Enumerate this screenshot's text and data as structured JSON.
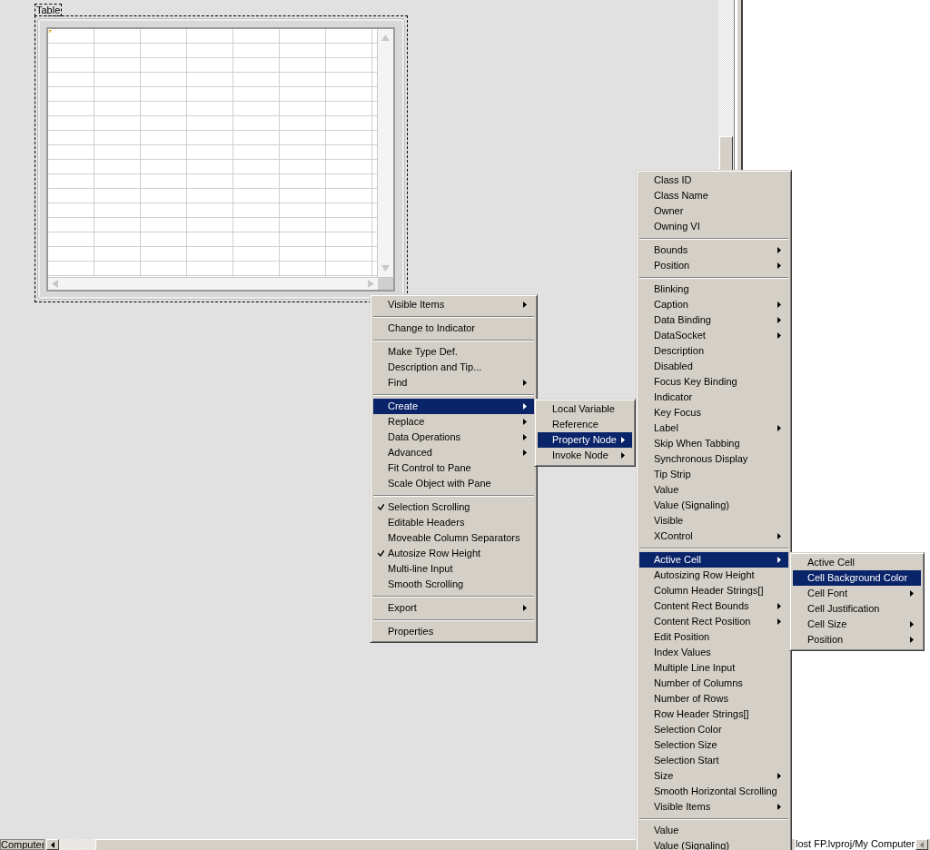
{
  "table": {
    "label": "Table"
  },
  "status_bar": {
    "left_text": "Computer",
    "right_text": "lost FP.lvproj/My Computer"
  },
  "menus": [
    {
      "groups": [
        [
          {
            "label": "Visible Items",
            "submenu": true,
            "selected": false,
            "checked": false
          }
        ],
        [
          {
            "label": "Change to Indicator",
            "submenu": false,
            "selected": false,
            "checked": false
          }
        ],
        [
          {
            "label": "Make Type Def.",
            "submenu": false,
            "selected": false,
            "checked": false
          },
          {
            "label": "Description and Tip...",
            "submenu": false,
            "selected": false,
            "checked": false
          },
          {
            "label": "Find",
            "submenu": true,
            "selected": false,
            "checked": false
          }
        ],
        [
          {
            "label": "Create",
            "submenu": true,
            "selected": true,
            "checked": false
          },
          {
            "label": "Replace",
            "submenu": true,
            "selected": false,
            "checked": false
          },
          {
            "label": "Data Operations",
            "submenu": true,
            "selected": false,
            "checked": false
          },
          {
            "label": "Advanced",
            "submenu": true,
            "selected": false,
            "checked": false
          },
          {
            "label": "Fit Control to Pane",
            "submenu": false,
            "selected": false,
            "checked": false
          },
          {
            "label": "Scale Object with Pane",
            "submenu": false,
            "selected": false,
            "checked": false
          }
        ],
        [
          {
            "label": "Selection Scrolling",
            "submenu": false,
            "selected": false,
            "checked": true
          },
          {
            "label": "Editable Headers",
            "submenu": false,
            "selected": false,
            "checked": false
          },
          {
            "label": "Moveable Column Separators",
            "submenu": false,
            "selected": false,
            "checked": false
          },
          {
            "label": "Autosize Row Height",
            "submenu": false,
            "selected": false,
            "checked": true
          },
          {
            "label": "Multi-line Input",
            "submenu": false,
            "selected": false,
            "checked": false
          },
          {
            "label": "Smooth Scrolling",
            "submenu": false,
            "selected": false,
            "checked": false
          }
        ],
        [
          {
            "label": "Export",
            "submenu": true,
            "selected": false,
            "checked": false
          }
        ],
        [
          {
            "label": "Properties",
            "submenu": false,
            "selected": false,
            "checked": false
          }
        ]
      ]
    },
    {
      "groups": [
        [
          {
            "label": "Local Variable",
            "submenu": false,
            "selected": false
          },
          {
            "label": "Reference",
            "submenu": false,
            "selected": false
          },
          {
            "label": "Property Node",
            "submenu": true,
            "selected": true
          },
          {
            "label": "Invoke Node",
            "submenu": true,
            "selected": false
          }
        ]
      ]
    },
    {
      "groups": [
        [
          {
            "label": "Class ID",
            "submenu": false,
            "selected": false
          },
          {
            "label": "Class Name",
            "submenu": false,
            "selected": false
          },
          {
            "label": "Owner",
            "submenu": false,
            "selected": false
          },
          {
            "label": "Owning VI",
            "submenu": false,
            "selected": false
          }
        ],
        [
          {
            "label": "Bounds",
            "submenu": true,
            "selected": false
          },
          {
            "label": "Position",
            "submenu": true,
            "selected": false
          }
        ],
        [
          {
            "label": "Blinking",
            "submenu": false,
            "selected": false
          },
          {
            "label": "Caption",
            "submenu": true,
            "selected": false
          },
          {
            "label": "Data Binding",
            "submenu": true,
            "selected": false
          },
          {
            "label": "DataSocket",
            "submenu": true,
            "selected": false
          },
          {
            "label": "Description",
            "submenu": false,
            "selected": false
          },
          {
            "label": "Disabled",
            "submenu": false,
            "selected": false
          },
          {
            "label": "Focus Key Binding",
            "submenu": false,
            "selected": false
          },
          {
            "label": "Indicator",
            "submenu": false,
            "selected": false
          },
          {
            "label": "Key Focus",
            "submenu": false,
            "selected": false
          },
          {
            "label": "Label",
            "submenu": true,
            "selected": false
          },
          {
            "label": "Skip When Tabbing",
            "submenu": false,
            "selected": false
          },
          {
            "label": "Synchronous Display",
            "submenu": false,
            "selected": false
          },
          {
            "label": "Tip Strip",
            "submenu": false,
            "selected": false
          },
          {
            "label": "Value",
            "submenu": false,
            "selected": false
          },
          {
            "label": "Value (Signaling)",
            "submenu": false,
            "selected": false
          },
          {
            "label": "Visible",
            "submenu": false,
            "selected": false
          },
          {
            "label": "XControl",
            "submenu": true,
            "selected": false
          }
        ],
        [
          {
            "label": "Active Cell",
            "submenu": true,
            "selected": true
          },
          {
            "label": "Autosizing Row Height",
            "submenu": false,
            "selected": false
          },
          {
            "label": "Column Header Strings[]",
            "submenu": false,
            "selected": false
          },
          {
            "label": "Content Rect Bounds",
            "submenu": true,
            "selected": false
          },
          {
            "label": "Content Rect Position",
            "submenu": true,
            "selected": false
          },
          {
            "label": "Edit Position",
            "submenu": false,
            "selected": false
          },
          {
            "label": "Index Values",
            "submenu": false,
            "selected": false
          },
          {
            "label": "Multiple Line Input",
            "submenu": false,
            "selected": false
          },
          {
            "label": "Number of Columns",
            "submenu": false,
            "selected": false
          },
          {
            "label": "Number of Rows",
            "submenu": false,
            "selected": false
          },
          {
            "label": "Row Header Strings[]",
            "submenu": false,
            "selected": false
          },
          {
            "label": "Selection Color",
            "submenu": false,
            "selected": false
          },
          {
            "label": "Selection Size",
            "submenu": false,
            "selected": false
          },
          {
            "label": "Selection Start",
            "submenu": false,
            "selected": false
          },
          {
            "label": "Size",
            "submenu": true,
            "selected": false
          },
          {
            "label": "Smooth Horizontal Scrolling",
            "submenu": false,
            "selected": false
          },
          {
            "label": "Visible Items",
            "submenu": true,
            "selected": false
          }
        ],
        [
          {
            "label": "Value",
            "submenu": false,
            "selected": false
          },
          {
            "label": "Value (Signaling)",
            "submenu": false,
            "selected": false
          }
        ]
      ]
    },
    {
      "groups": [
        [
          {
            "label": "Active Cell",
            "submenu": false,
            "selected": false
          },
          {
            "label": "Cell Background Color",
            "submenu": false,
            "selected": true
          },
          {
            "label": "Cell Font",
            "submenu": true,
            "selected": false
          },
          {
            "label": "Cell Justification",
            "submenu": false,
            "selected": false
          },
          {
            "label": "Cell Size",
            "submenu": true,
            "selected": false
          },
          {
            "label": "Position",
            "submenu": true,
            "selected": false
          }
        ]
      ]
    }
  ]
}
